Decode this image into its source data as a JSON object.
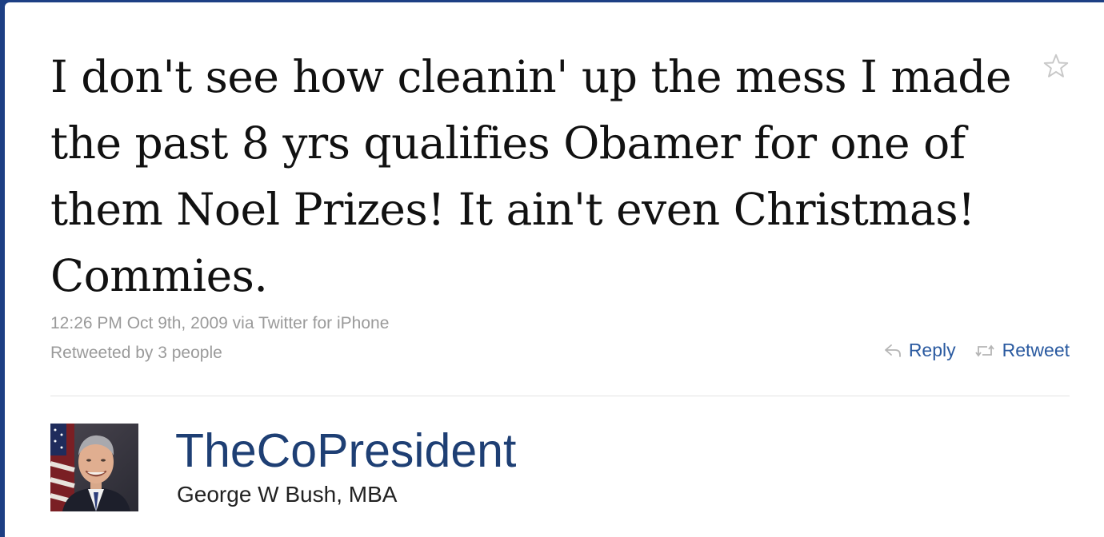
{
  "tweet": {
    "text": "I don't see how cleanin' up the mess I made the past 8 yrs qualifies Obamer for one of them Noel Prizes! It ain't even Christmas! Commies.",
    "timestamp": "12:26 PM Oct 9th, 2009",
    "via_label": "via",
    "source": "Twitter for iPhone",
    "retweeted_by": "Retweeted by 3 people",
    "favorite_icon": "star-outline-icon"
  },
  "actions": {
    "reply_label": "Reply",
    "reply_icon": "reply-arrow-icon",
    "retweet_label": "Retweet",
    "retweet_icon": "retweet-arrows-icon"
  },
  "author": {
    "screen_name": "TheCoPresident",
    "full_name": "George W Bush, MBA",
    "avatar": "profile-photo"
  },
  "colors": {
    "link": "#2a5aa0",
    "screen_name": "#1e3f74",
    "meta_text": "#9a9a9a",
    "frame": "#1d3f84"
  }
}
